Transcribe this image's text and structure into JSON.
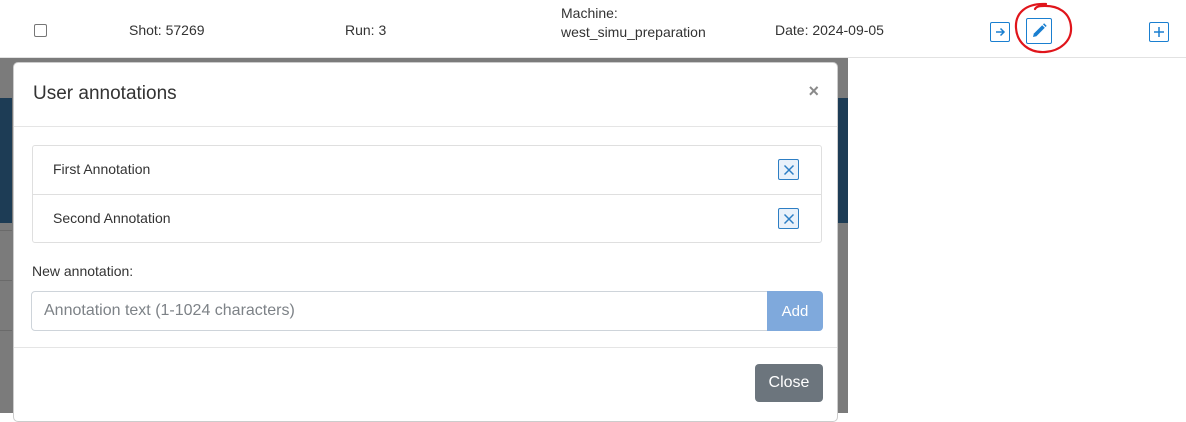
{
  "row": {
    "shot": "Shot: 57269",
    "run": "Run: 3",
    "machine_label": "Machine:",
    "machine_value": "west_simu_preparation",
    "date": "Date: 2024-09-05",
    "icons": {
      "go": "arrow-right-icon",
      "edit": "pencil-edit-icon",
      "add": "plus-icon"
    },
    "highlight_color": "#e0151b"
  },
  "modal": {
    "title": "User annotations",
    "close_symbol": "×",
    "annotations": [
      {
        "label": "First Annotation",
        "delete_icon": "close-box-icon"
      },
      {
        "label": "Second Annotation",
        "delete_icon": "close-box-icon"
      }
    ],
    "new_label": "New annotation:",
    "input": {
      "value": "",
      "placeholder": "Annotation text (1-1024 characters)"
    },
    "add_label": "Add",
    "close_label": "Close"
  },
  "colors": {
    "accent": "#1a7fd0",
    "add_button": "#7fa9dc",
    "close_button": "#6c757d",
    "backdrop": "#7b7b7b"
  }
}
